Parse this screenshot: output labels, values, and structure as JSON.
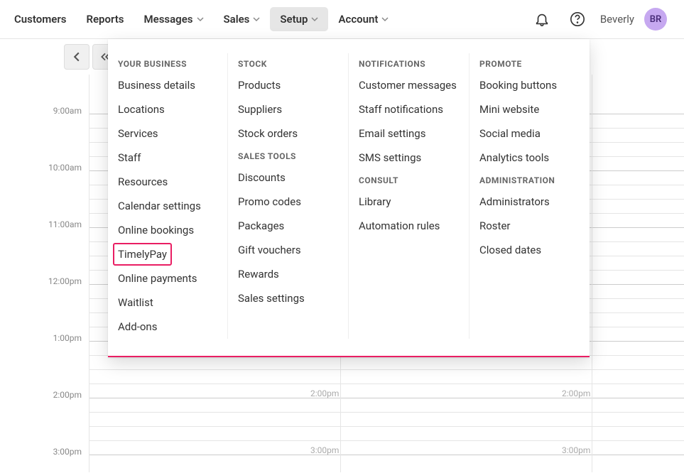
{
  "topnav": {
    "items": [
      {
        "label": "Customers",
        "hasDropdown": false
      },
      {
        "label": "Reports",
        "hasDropdown": false
      },
      {
        "label": "Messages",
        "hasDropdown": true
      },
      {
        "label": "Sales",
        "hasDropdown": true
      },
      {
        "label": "Setup",
        "hasDropdown": true,
        "active": true
      },
      {
        "label": "Account",
        "hasDropdown": true
      }
    ]
  },
  "user": {
    "name": "Beverly",
    "initials": "BR",
    "avatarBg": "#c6a8f0"
  },
  "calendar": {
    "times": [
      "9:00am",
      "10:00am",
      "11:00am",
      "12:00pm",
      "1:00pm",
      "2:00pm",
      "3:00pm"
    ],
    "cellTimes": [
      "2:00pm",
      "3:00pm"
    ]
  },
  "menu": {
    "columns": [
      {
        "sections": [
          {
            "heading": "YOUR BUSINESS",
            "items": [
              "Business details",
              "Locations",
              "Services",
              "Staff",
              "Resources",
              "Calendar settings",
              "Online bookings",
              "TimelyPay",
              "Online payments",
              "Waitlist",
              "Add-ons"
            ]
          }
        ]
      },
      {
        "sections": [
          {
            "heading": "STOCK",
            "items": [
              "Products",
              "Suppliers",
              "Stock orders"
            ]
          },
          {
            "heading": "SALES TOOLS",
            "items": [
              "Discounts",
              "Promo codes",
              "Packages",
              "Gift vouchers",
              "Rewards",
              "Sales settings"
            ]
          }
        ]
      },
      {
        "sections": [
          {
            "heading": "NOTIFICATIONS",
            "items": [
              "Customer messages",
              "Staff notifications",
              "Email settings",
              "SMS settings"
            ]
          },
          {
            "heading": "CONSULT",
            "items": [
              "Library",
              "Automation rules"
            ]
          }
        ]
      },
      {
        "sections": [
          {
            "heading": "PROMOTE",
            "items": [
              "Booking buttons",
              "Mini website",
              "Social media",
              "Analytics tools"
            ]
          },
          {
            "heading": "ADMINISTRATION",
            "items": [
              "Administrators",
              "Roster",
              "Closed dates"
            ]
          }
        ]
      }
    ],
    "highlighted": "TimelyPay"
  }
}
